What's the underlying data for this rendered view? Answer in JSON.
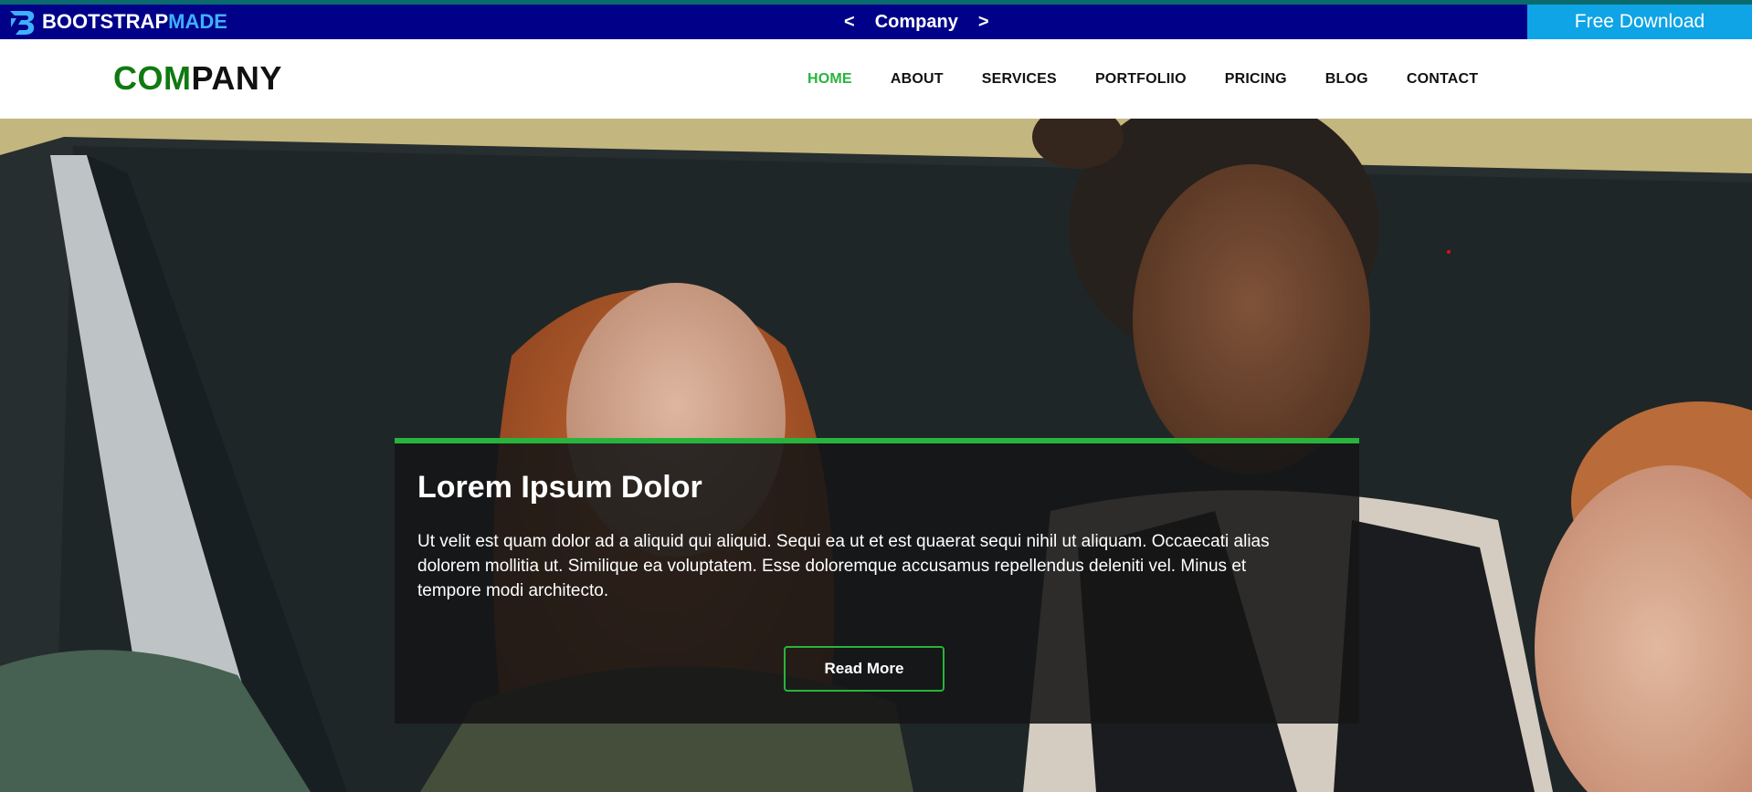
{
  "topbar": {
    "brand": {
      "part1": "BOOTSTRAP",
      "part2": "MADE",
      "icon": "bootstrapmade-logo-icon"
    },
    "switcher": {
      "prev": "<",
      "title": "Company",
      "next": ">"
    },
    "free_download": "Free Download"
  },
  "header": {
    "logo": {
      "part1": "COM",
      "part2": "PANY"
    },
    "nav": [
      {
        "label": "HOME",
        "active": true
      },
      {
        "label": "ABOUT",
        "active": false
      },
      {
        "label": "SERVICES",
        "active": false
      },
      {
        "label": "PORTFOLIIO",
        "active": false
      },
      {
        "label": "PRICING",
        "active": false
      },
      {
        "label": "BLOG",
        "active": false
      },
      {
        "label": "CONTACT",
        "active": false
      }
    ]
  },
  "hero": {
    "title": "Lorem Ipsum Dolor",
    "text": "Ut velit est quam dolor ad a aliquid qui aliquid. Sequi ea ut et est quaerat sequi nihil ut aliquam. Occaecati alias dolorem mollitia ut. Similique ea voluptatem. Esse doloremque accusamus repellendus deleniti vel. Minus et tempore modi architecto.",
    "button": "Read More"
  },
  "colors": {
    "topbar_bg": "#000088",
    "download_bg": "#0ea4e6",
    "accent_green": "#28b43c",
    "logo_green": "#107a10"
  }
}
